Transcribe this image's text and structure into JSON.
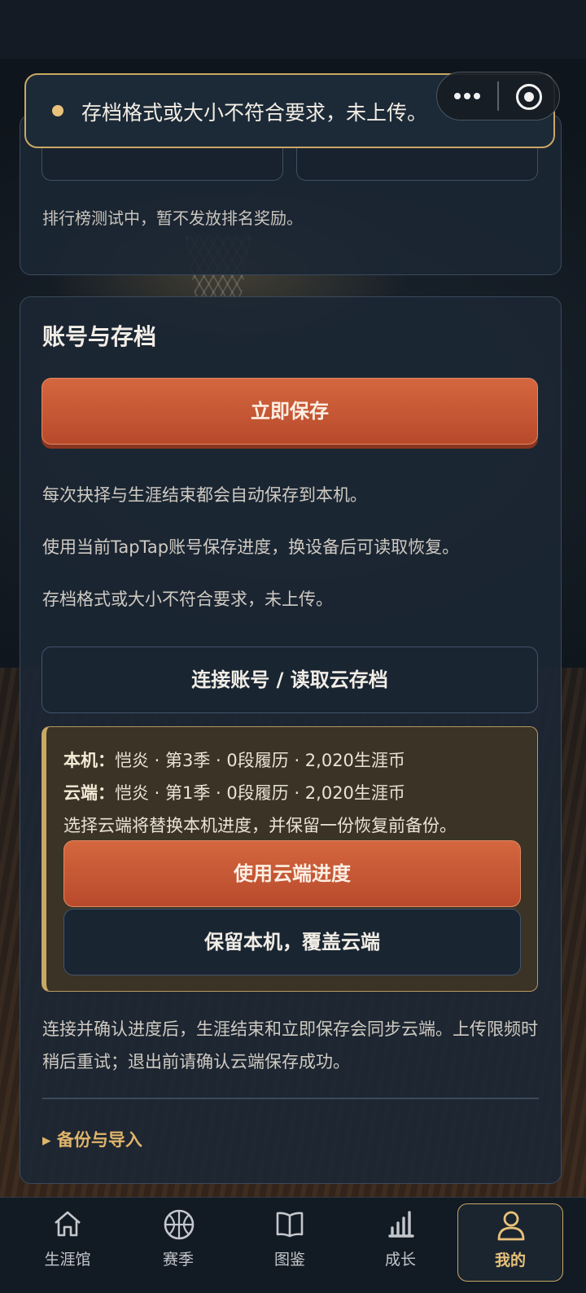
{
  "toast": {
    "message": "存档格式或大小不符合要求，未上传。"
  },
  "capsule": {
    "more_icon": "more-dots-icon",
    "close_icon": "close-target-icon"
  },
  "leaderboard": {
    "note": "排行榜测试中，暂不发放排名奖励。"
  },
  "account_section": {
    "title": "账号与存档",
    "save_now_label": "立即保存",
    "info_lines": [
      "每次抉择与生涯结束都会自动保存到本机。",
      "使用当前TapTap账号保存进度，换设备后可读取恢复。",
      "存档格式或大小不符合要求，未上传。"
    ],
    "connect_label": "连接账号 / 读取云存档",
    "conflict": {
      "local_key": "本机：",
      "local_value": "恺炎 · 第3季 · 0段履历 · 2,020生涯币",
      "cloud_key": "云端：",
      "cloud_value": "恺炎 · 第1季 · 0段履历 · 2,020生涯币",
      "hint": "选择云端将替换本机进度，并保留一份恢复前备份。",
      "use_cloud_label": "使用云端进度",
      "keep_local_label": "保留本机，覆盖云端"
    },
    "sync_note": "连接并确认进度后，生涯结束和立即保存会同步云端。上传限频时稍后重试；退出前请确认云端保存成功。",
    "backup_toggle": "▸ 备份与导入"
  },
  "tabbar": {
    "items": [
      {
        "label": "生涯馆",
        "icon": "home-icon"
      },
      {
        "label": "赛季",
        "icon": "basketball-icon"
      },
      {
        "label": "图鉴",
        "icon": "book-icon"
      },
      {
        "label": "成长",
        "icon": "bar-chart-icon"
      },
      {
        "label": "我的",
        "icon": "user-icon",
        "active": true
      }
    ]
  },
  "colors": {
    "accent": "#c9a864",
    "primary": "#c4583a",
    "card": "#1c2734"
  }
}
